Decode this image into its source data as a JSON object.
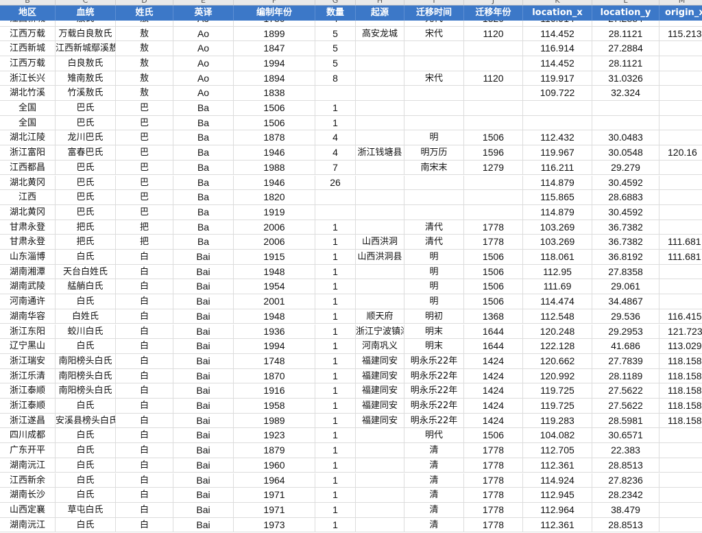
{
  "sheet": {
    "column_letters": [
      "B",
      "C",
      "D",
      "E",
      "F",
      "G",
      "H",
      "I",
      "J",
      "K",
      "L",
      "M"
    ],
    "headers": [
      "地区",
      "血统",
      "姓氏",
      "英译",
      "编制年份",
      "数量",
      "起源",
      "迁移时间",
      "迁移年份",
      "location_x",
      "location_y",
      "origin_x"
    ],
    "partial_top_row": [
      "江西新城",
      "敖氏",
      "敖",
      "Ao",
      "1780",
      "4",
      "",
      "元代",
      "1320",
      "116.914",
      "27.2884",
      ""
    ],
    "rows": [
      [
        "江西万载",
        "万载白良敖氏",
        "敖",
        "Ao",
        "1899",
        "5",
        "高安龙城",
        "宋代",
        "1120",
        "114.452",
        "28.1121",
        "115.213"
      ],
      [
        "江西新城",
        "江西新城鄢溪敖氏",
        "敖",
        "Ao",
        "1847",
        "5",
        "",
        "",
        "",
        "116.914",
        "27.2884",
        ""
      ],
      [
        "江西万载",
        "白良敖氏",
        "敖",
        "Ao",
        "1994",
        "5",
        "",
        "",
        "",
        "114.452",
        "28.1121",
        ""
      ],
      [
        "浙江长兴",
        "雉南敖氏",
        "敖",
        "Ao",
        "1894",
        "8",
        "",
        "宋代",
        "1120",
        "119.917",
        "31.0326",
        ""
      ],
      [
        "湖北竹溪",
        "竹溪敖氏",
        "敖",
        "Ao",
        "1838",
        "",
        "",
        "",
        "",
        "109.722",
        "32.324",
        ""
      ],
      [
        "全国",
        "巴氏",
        "巴",
        "Ba",
        "1506",
        "1",
        "",
        "",
        "",
        "",
        "",
        ""
      ],
      [
        "全国",
        "巴氏",
        "巴",
        "Ba",
        "1506",
        "1",
        "",
        "",
        "",
        "",
        "",
        ""
      ],
      [
        "湖北江陵",
        "龙川巴氏",
        "巴",
        "Ba",
        "1878",
        "4",
        "",
        "明",
        "1506",
        "112.432",
        "30.0483",
        ""
      ],
      [
        "浙江富阳",
        "富春巴氏",
        "巴",
        "Ba",
        "1946",
        "4",
        "浙江钱塘县",
        "明万历",
        "1596",
        "119.967",
        "30.0548",
        "120.16"
      ],
      [
        "江西都昌",
        "巴氏",
        "巴",
        "Ba",
        "1988",
        "7",
        "",
        "南宋末",
        "1279",
        "116.211",
        "29.279",
        ""
      ],
      [
        "湖北黄冈",
        "巴氏",
        "巴",
        "Ba",
        "1946",
        "26",
        "",
        "",
        "",
        "114.879",
        "30.4592",
        ""
      ],
      [
        "江西",
        "巴氏",
        "巴",
        "Ba",
        "1820",
        "",
        "",
        "",
        "",
        "115.865",
        "28.6883",
        ""
      ],
      [
        "湖北黄冈",
        "巴氏",
        "巴",
        "Ba",
        "1919",
        "",
        "",
        "",
        "",
        "114.879",
        "30.4592",
        ""
      ],
      [
        "甘肃永登",
        "把氏",
        "把",
        "Ba",
        "2006",
        "1",
        "",
        "清代",
        "1778",
        "103.269",
        "36.7382",
        ""
      ],
      [
        "甘肃永登",
        "把氏",
        "把",
        "Ba",
        "2006",
        "1",
        "山西洪洞",
        "清代",
        "1778",
        "103.269",
        "36.7382",
        "111.681"
      ],
      [
        "山东淄博",
        "白氏",
        "白",
        "Bai",
        "1915",
        "1",
        "山西洪洞县",
        "明",
        "1506",
        "118.061",
        "36.8192",
        "111.681"
      ],
      [
        "湖南湘潭",
        "天台白姓氏",
        "白",
        "Bai",
        "1948",
        "1",
        "",
        "明",
        "1506",
        "112.95",
        "27.8358",
        ""
      ],
      [
        "湖南武陵",
        "艋艄白氏",
        "白",
        "Bai",
        "1954",
        "1",
        "",
        "明",
        "1506",
        "111.69",
        "29.061",
        ""
      ],
      [
        "河南通许",
        "白氏",
        "白",
        "Bai",
        "2001",
        "1",
        "",
        "明",
        "1506",
        "114.474",
        "34.4867",
        ""
      ],
      [
        "湖南华容",
        "白姓氏",
        "白",
        "Bai",
        "1948",
        "1",
        "顺天府",
        "明初",
        "1368",
        "112.548",
        "29.536",
        "116.415"
      ],
      [
        "浙江东阳",
        "蛟川白氏",
        "白",
        "Bai",
        "1936",
        "1",
        "浙江宁波镇海县",
        "明末",
        "1644",
        "120.248",
        "29.2953",
        "121.723"
      ],
      [
        "辽宁黑山",
        "白氏",
        "白",
        "Bai",
        "1994",
        "1",
        "河南巩义",
        "明末",
        "1644",
        "122.128",
        "41.686",
        "113.029"
      ],
      [
        "浙江瑞安",
        "南阳榜头白氏",
        "白",
        "Bai",
        "1748",
        "1",
        "福建同安",
        "明永乐22年",
        "1424",
        "120.662",
        "27.7839",
        "118.158"
      ],
      [
        "浙江乐清",
        "南阳榜头白氏",
        "白",
        "Bai",
        "1870",
        "1",
        "福建同安",
        "明永乐22年",
        "1424",
        "120.992",
        "28.1189",
        "118.158"
      ],
      [
        "浙江泰顺",
        "南阳榜头白氏",
        "白",
        "Bai",
        "1916",
        "1",
        "福建同安",
        "明永乐22年",
        "1424",
        "119.725",
        "27.5622",
        "118.158"
      ],
      [
        "浙江泰顺",
        "白氏",
        "白",
        "Bai",
        "1958",
        "1",
        "福建同安",
        "明永乐22年",
        "1424",
        "119.725",
        "27.5622",
        "118.158"
      ],
      [
        "浙江遂昌",
        "安溪县榜头白氏",
        "白",
        "Bai",
        "1989",
        "1",
        "福建同安",
        "明永乐22年",
        "1424",
        "119.283",
        "28.5981",
        "118.158"
      ],
      [
        "四川成都",
        "白氏",
        "白",
        "Bai",
        "1923",
        "1",
        "",
        "明代",
        "1506",
        "104.082",
        "30.6571",
        ""
      ],
      [
        "广东开平",
        "白氏",
        "白",
        "Bai",
        "1879",
        "1",
        "",
        "清",
        "1778",
        "112.705",
        "22.383",
        ""
      ],
      [
        "湖南沅江",
        "白氏",
        "白",
        "Bai",
        "1960",
        "1",
        "",
        "清",
        "1778",
        "112.361",
        "28.8513",
        ""
      ],
      [
        "江西新余",
        "白氏",
        "白",
        "Bai",
        "1964",
        "1",
        "",
        "清",
        "1778",
        "114.924",
        "27.8236",
        ""
      ],
      [
        "湖南长沙",
        "白氏",
        "白",
        "Bai",
        "1971",
        "1",
        "",
        "清",
        "1778",
        "112.945",
        "28.2342",
        ""
      ],
      [
        "山西定襄",
        "草屯白氏",
        "白",
        "Bai",
        "1971",
        "1",
        "",
        "清",
        "1778",
        "112.964",
        "38.479",
        ""
      ],
      [
        "湖南沅江",
        "白氏",
        "白",
        "Bai",
        "1973",
        "1",
        "",
        "清",
        "1778",
        "112.361",
        "28.8513",
        ""
      ]
    ]
  }
}
